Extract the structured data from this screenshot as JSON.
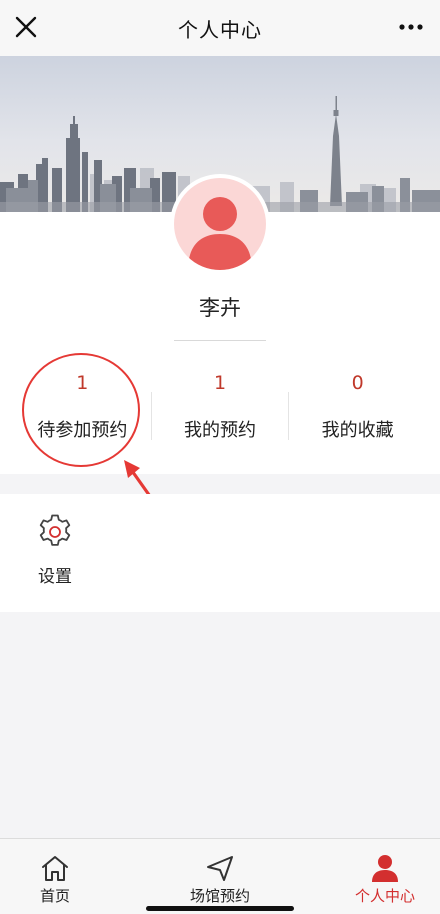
{
  "header": {
    "title": "个人中心",
    "close_icon": "close-icon",
    "more_icon": "more-icon"
  },
  "profile": {
    "username": "李卉",
    "avatar_icon": "user-icon"
  },
  "stats": [
    {
      "value": "1",
      "label": "待参加预约"
    },
    {
      "value": "1",
      "label": "我的预约"
    },
    {
      "value": "0",
      "label": "我的收藏"
    }
  ],
  "settings": {
    "label": "设置",
    "icon": "gear-icon"
  },
  "tabbar": [
    {
      "label": "首页",
      "icon": "home-icon",
      "active": false
    },
    {
      "label": "场馆预约",
      "icon": "navigation-icon",
      "active": false
    },
    {
      "label": "个人中心",
      "icon": "person-icon",
      "active": true
    }
  ],
  "colors": {
    "accent": "#d32f2f",
    "stat_number": "#c0392b",
    "annotation": "#e53935"
  }
}
